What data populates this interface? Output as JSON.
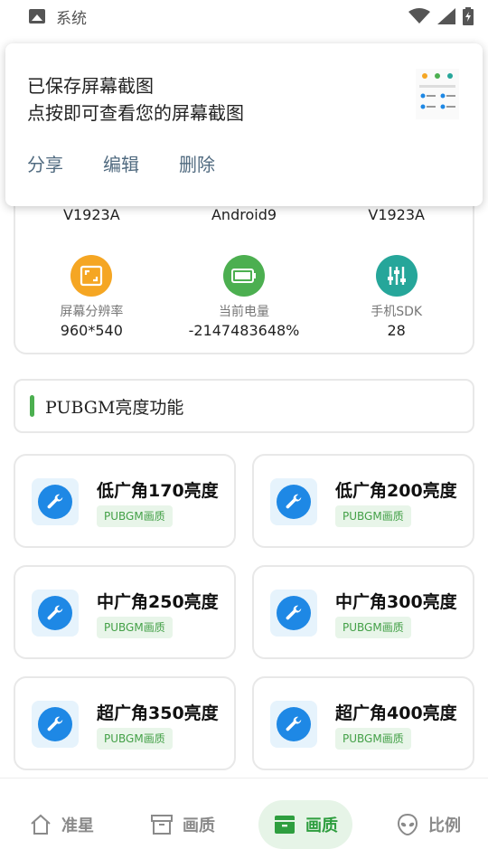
{
  "status_bar": {
    "app_label": "系统",
    "icons": [
      "image-icon",
      "wifi-icon",
      "signal-icon",
      "battery-charging-icon"
    ]
  },
  "notification": {
    "title_line1": "已保存屏幕截图",
    "title_line2": "点按即可查看您的屏幕截图",
    "actions": {
      "share": "分享",
      "edit": "编辑",
      "delete": "删除"
    }
  },
  "device_info": {
    "top_row": [
      "V1923A",
      "Android9",
      "V1923A"
    ],
    "stats": [
      {
        "label": "屏幕分辨率",
        "value": "960*540",
        "icon": "resolution-icon",
        "color": "#f5a623"
      },
      {
        "label": "当前电量",
        "value": "-2147483648%",
        "icon": "battery-icon",
        "color": "#4caf50"
      },
      {
        "label": "手机SDK",
        "value": "28",
        "icon": "sliders-icon",
        "color": "#26a69a"
      }
    ]
  },
  "section": {
    "title": "PUBGM亮度功能"
  },
  "features": [
    {
      "name": "低广角170亮度",
      "tag": "PUBGM画质"
    },
    {
      "name": "低广角200亮度",
      "tag": "PUBGM画质"
    },
    {
      "name": "中广角250亮度",
      "tag": "PUBGM画质"
    },
    {
      "name": "中广角300亮度",
      "tag": "PUBGM画质"
    },
    {
      "name": "超广角350亮度",
      "tag": "PUBGM画质"
    },
    {
      "name": "超广角400亮度",
      "tag": "PUBGM画质"
    }
  ],
  "bottom_nav": [
    {
      "label": "准星",
      "icon": "home-icon",
      "active": false
    },
    {
      "label": "画质",
      "icon": "archive-icon",
      "active": false
    },
    {
      "label": "画质",
      "icon": "archive-filled-icon",
      "active": true
    },
    {
      "label": "比例",
      "icon": "alien-icon",
      "active": false
    }
  ],
  "colors": {
    "accent_green": "#4caf50",
    "tool_blue": "#1e88e5",
    "nav_active_bg": "#e6f4e7"
  }
}
